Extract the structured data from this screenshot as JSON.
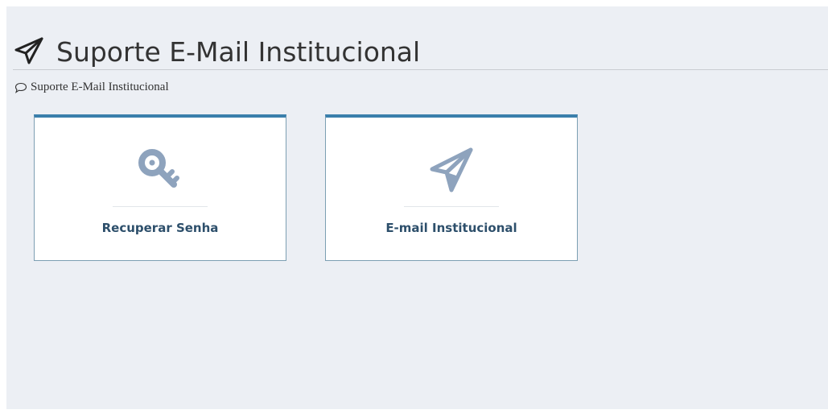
{
  "header": {
    "title": "Suporte E-Mail Institucional",
    "icon": "paper-plane-icon"
  },
  "breadcrumb": {
    "label": "Suporte E-Mail Institucional",
    "icon": "speech-bubble-icon"
  },
  "tiles": [
    {
      "label": "Recuperar Senha",
      "icon": "key-icon"
    },
    {
      "label": "E-mail Institucional",
      "icon": "paper-plane-icon"
    }
  ],
  "colors": {
    "background": "#eceff4",
    "tile_top_border": "#3a7fab",
    "tile_border": "#7c9fb3",
    "tile_icon": "#8ea3bd",
    "tile_label": "#2d4f6b",
    "title_text": "#333333"
  }
}
